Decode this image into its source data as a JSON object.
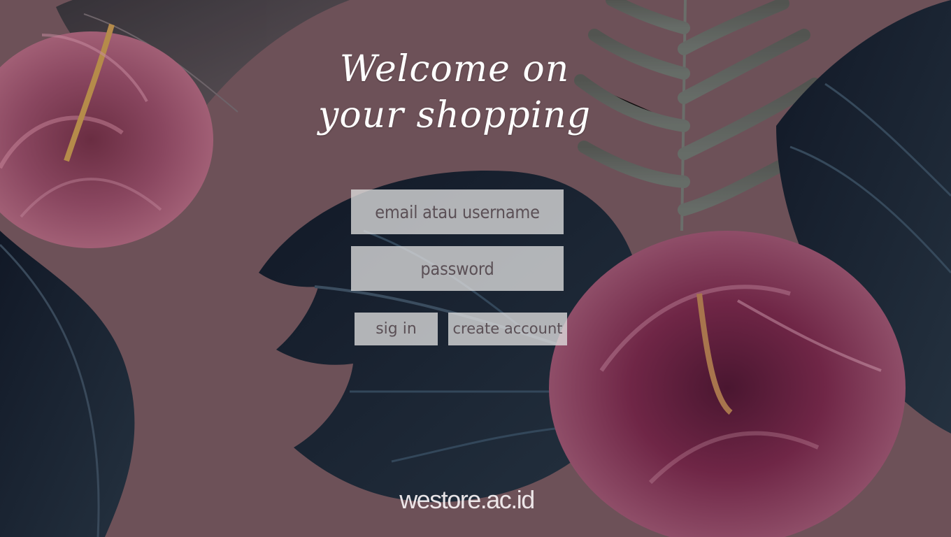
{
  "hero": {
    "line1": "Welcome on",
    "line2": "your shopping"
  },
  "form": {
    "email_placeholder": "email atau username",
    "password_placeholder": "password",
    "signin_label": "sig in",
    "create_label": "create account"
  },
  "footer": {
    "domain": "westore.ac.id"
  },
  "theme": {
    "background": "#6d5158",
    "input_bg": "#dedede",
    "text": "#ffffff",
    "input_text": "#5b5056"
  },
  "decor": {
    "icons": [
      "hibiscus-flower-icon",
      "tropical-leaf-icon",
      "fern-leaf-icon"
    ]
  }
}
